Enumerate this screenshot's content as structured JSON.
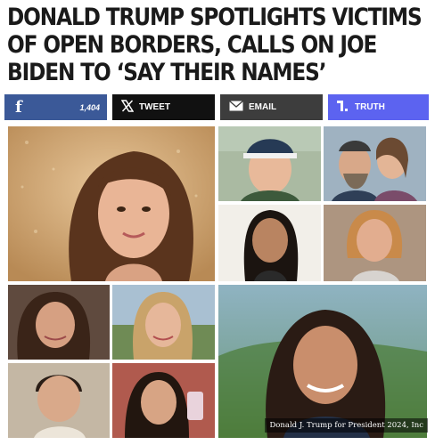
{
  "article": {
    "headline": "DONALD TRUMP SPOTLIGHTS VICTIMS OF OPEN BORDERS, CALLS ON JOE BIDEN TO ‘SAY THEIR NAMES’"
  },
  "share": {
    "facebook": {
      "icon": "f",
      "count": "1,404"
    },
    "x": {
      "label": "TWEET"
    },
    "email": {
      "label": "EMAIL"
    },
    "truth": {
      "label": "TRUTH"
    }
  },
  "photo": {
    "caption": "Donald J. Trump for President 2024, Inc"
  },
  "colors": {
    "facebook": "#3b5998",
    "x": "#111111",
    "email": "#3d3d3d",
    "truth": "#5c63f0"
  }
}
